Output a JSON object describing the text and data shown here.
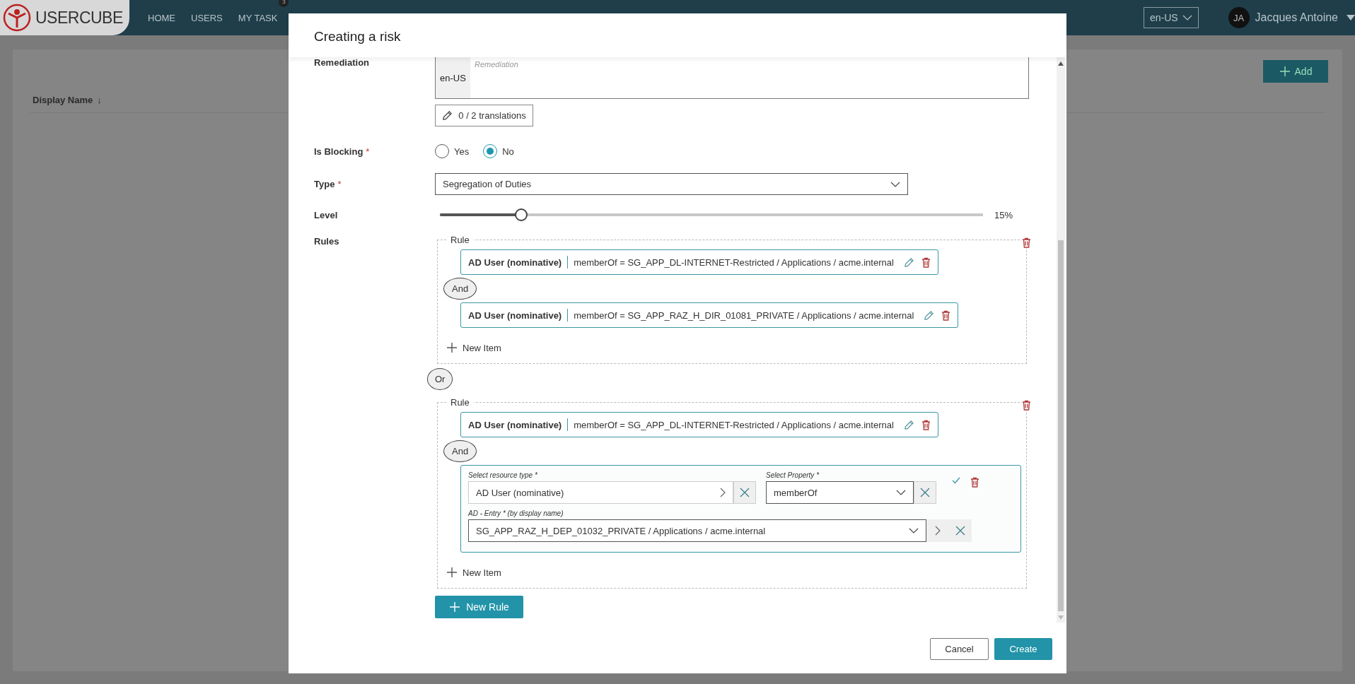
{
  "app_header": {
    "logo": "USERCUBE",
    "nav": [
      {
        "label": "HOME"
      },
      {
        "label": "USERS"
      },
      {
        "label": "MY TASK",
        "badge": "3"
      }
    ],
    "language": "en-US",
    "user": {
      "initials": "JA",
      "name": "Jacques Antoine"
    }
  },
  "page": {
    "add_button": "Add",
    "columns": [
      {
        "label": "Display Name",
        "sort": "↓"
      }
    ]
  },
  "dialog": {
    "title": "Creating a risk",
    "fields": [
      {
        "kind": "translated_text",
        "label": "Remediation",
        "language": "en-US",
        "placeholder": "Remediation",
        "translations_button": "0 / 2 translations"
      },
      {
        "kind": "radio",
        "label": "Is Blocking",
        "required_mark": "*",
        "options": [
          {
            "label": "Yes",
            "selected": false
          },
          {
            "label": "No",
            "selected": true
          }
        ]
      },
      {
        "kind": "select",
        "label": "Type",
        "required_mark": "*",
        "value": "Segregation of Duties"
      },
      {
        "kind": "slider",
        "label": "Level",
        "level": 0.15,
        "reading": "15%"
      },
      {
        "kind": "rules",
        "label": "Rules",
        "blocks": [
          {
            "kind": "rule",
            "title": "Rule",
            "new_item": "New Item",
            "items": [
              {
                "kind": "condition",
                "resource": "AD User (nominative)",
                "expression": "memberOf = SG_APP_DL-INTERNET-Restricted / Applications / acme.internal"
              },
              {
                "kind": "connector",
                "label": "And"
              },
              {
                "kind": "condition",
                "resource": "AD User (nominative)",
                "expression": "memberOf = SG_APP_RAZ_H_DIR_01081_PRIVATE / Applications / acme.internal"
              }
            ]
          },
          {
            "kind": "connector",
            "label": "Or"
          },
          {
            "kind": "rule",
            "title": "Rule",
            "new_item": "New Item",
            "items": [
              {
                "kind": "condition",
                "resource": "AD User (nominative)",
                "expression": "memberOf = SG_APP_DL-INTERNET-Restricted / Applications / acme.internal"
              },
              {
                "kind": "connector",
                "label": "And"
              },
              {
                "kind": "editor",
                "resource_label": "Select resource type *",
                "resource_value": "AD User (nominative)",
                "property_label": "Select Property *",
                "property_value": "memberOf",
                "entry_label": "AD - Entry * (by display name)",
                "entry_value": "SG_APP_RAZ_H_DEP_01032_PRIVATE / Applications / acme.internal"
              }
            ]
          }
        ],
        "new_rule_button": "New Rule"
      }
    ],
    "buttons": [
      {
        "label": "Cancel",
        "kind": "secondary"
      },
      {
        "label": "Create",
        "kind": "primary"
      }
    ]
  }
}
